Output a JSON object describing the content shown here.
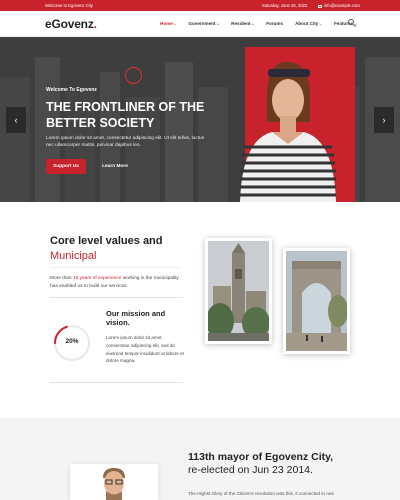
{
  "topbar": {
    "welcome": "Welcome to Egovenz City",
    "date": "Saturday, June 25, 2022",
    "email": "info@example.com"
  },
  "nav": {
    "logo": "eGovenz",
    "logo_dot": ".",
    "items": [
      {
        "label": "Home",
        "caret": "⌵"
      },
      {
        "label": "Government",
        "caret": "⌵"
      },
      {
        "label": "Resident",
        "caret": "⌵"
      },
      {
        "label": "Forums",
        "caret": ""
      },
      {
        "label": "About City",
        "caret": "⌵"
      },
      {
        "label": "Features",
        "caret": "⌵"
      }
    ]
  },
  "hero": {
    "welcome": "Welcome To Egovenz",
    "title": "THE FRONTLINER OF THE BETTER SOCIETY",
    "text": "Lorem ipsum dolor sit amet, consectetur adipiscing elit. Ut elit tellus, luctus nec ullamcorper mattis, pulvinar dapibus leo.",
    "support_label": "Support Us",
    "learn_label": "Learn More",
    "prev_arrow": "‹",
    "next_arrow": "›"
  },
  "core": {
    "title": "Core level values and",
    "title_red": "Municipal",
    "text_before": "More than ",
    "text_red": "15 years of experience",
    "text_after": " working in the municipality has enabled us to build our services."
  },
  "mission": {
    "progress": "20%",
    "progress_value": 20,
    "title": "Our mission and vision.",
    "text": "Lorem ipsum dolor sit amet, consectetur adipiscing elit, sed do eiusmod tempor incididunt ut labore et dolore magna."
  },
  "mayor": {
    "title": "113th mayor of Egovenz City,",
    "subtitle": "re-elected on Jun 23 2014.",
    "text": "The Highst Glory of the Citizen's revolution was this, it connected in one"
  },
  "colors": {
    "accent": "#c8232c",
    "dark": "#222222"
  }
}
